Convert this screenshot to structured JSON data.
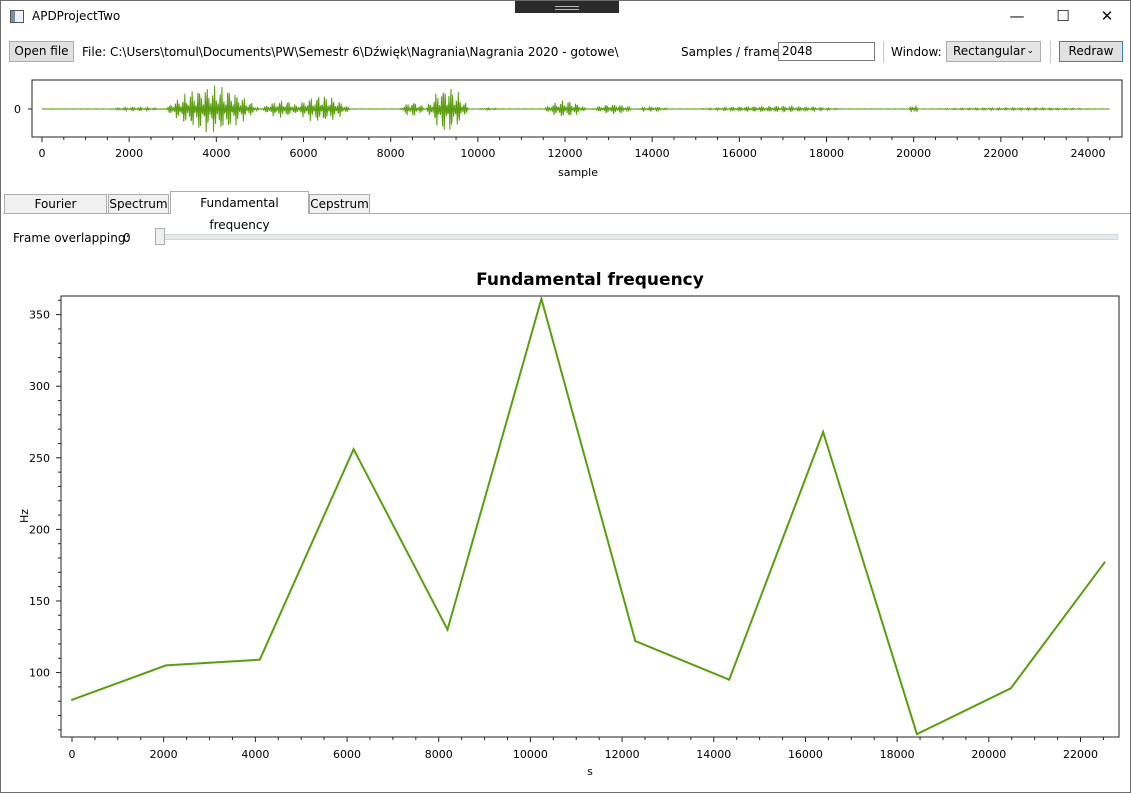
{
  "window": {
    "title": "APDProjectTwo",
    "minimize": "—",
    "maximize": "☐",
    "close": "✕"
  },
  "toolbar": {
    "open_file_label": "Open file",
    "file_label": "File:",
    "file_path": "C:\\Users\\tomul\\Documents\\PW\\Semestr 6\\Dźwięk\\Nagrania\\Nagrania 2020 - gotowe\\",
    "samples_label": "Samples / frame:",
    "samples_value": "2048",
    "window_label": "Window:",
    "window_value": "Rectangular",
    "redraw_label": "Redraw"
  },
  "waveform": {
    "y_tick": "0",
    "x_label": "sample",
    "x_ticks": [
      "0",
      "2000",
      "4000",
      "6000",
      "8000",
      "10000",
      "12000",
      "14000",
      "16000",
      "18000",
      "20000",
      "22000",
      "24000"
    ],
    "color": "#5a9e0f"
  },
  "tabs": [
    "Fourier transform",
    "Spectrum",
    "Fundamental frequency",
    "Cepstrum"
  ],
  "active_tab": "Fundamental frequency",
  "overlap": {
    "label": "Frame overlapping:",
    "value": "0",
    "slider_fraction": 0
  },
  "chart_data": {
    "type": "line",
    "title": "Fundamental frequency",
    "xlabel": "s",
    "ylabel": "Hz",
    "x": [
      0,
      2048,
      4096,
      6144,
      8192,
      10240,
      12288,
      14336,
      16384,
      18432,
      20480,
      22528
    ],
    "values": [
      81,
      105,
      109,
      256,
      130,
      361,
      122,
      95,
      268,
      57,
      89,
      177
    ],
    "xlim": [
      -240,
      22840
    ],
    "ylim": [
      55,
      363
    ],
    "xticks": [
      0,
      2000,
      4000,
      6000,
      8000,
      10000,
      12000,
      14000,
      16000,
      18000,
      20000,
      22000
    ],
    "yticks": [
      100,
      150,
      200,
      250,
      300,
      350
    ],
    "color": "#5a9e0f"
  }
}
